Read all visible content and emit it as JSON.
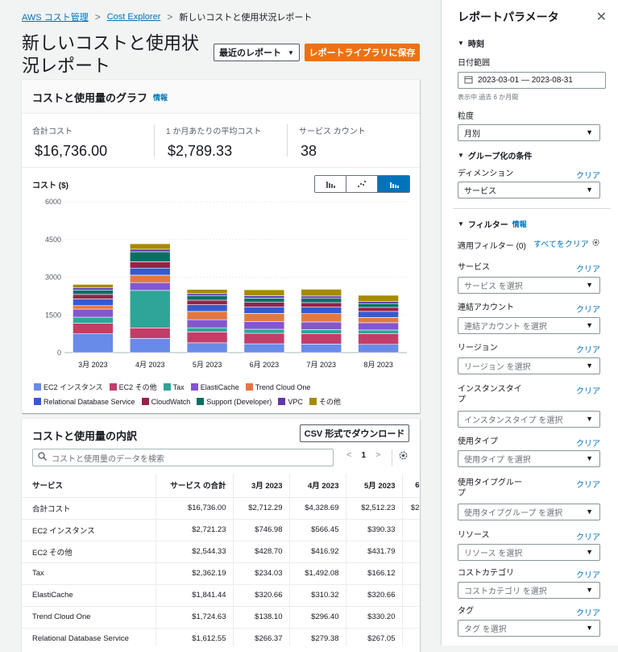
{
  "breadcrumb": {
    "item1": "AWS コスト管理",
    "item2": "Cost Explorer",
    "current": "新しいコストと使用状況レポート"
  },
  "page_title": "新しいコストと使用状況レポート",
  "buttons": {
    "recent_reports": "最近のレポート",
    "save_to_library": "レポートライブラリに保存",
    "csv_download": "CSV 形式でダウンロード"
  },
  "graph_card": {
    "title": "コストと使用量のグラフ",
    "info": "情報",
    "total_cost_label": "合計コスト",
    "total_cost": "$16,736.00",
    "avg_cost_label": "1 か月あたりの平均コスト",
    "avg_cost": "$2,789.33",
    "service_count_label": "サービス カウント",
    "service_count": "38",
    "chart_label": "コスト ($)"
  },
  "chart_data": {
    "type": "bar",
    "stacked": true,
    "ylabel": "コスト ($)",
    "ylim": [
      0,
      6000
    ],
    "yticks": [
      "0",
      "1500",
      "3000",
      "4500",
      "6000"
    ],
    "categories": [
      "3月 2023",
      "4月 2023",
      "5月 2023",
      "6月 2023",
      "7月 2023",
      "8月 2023"
    ],
    "series": [
      {
        "name": "EC2 インスタンス",
        "color": "#688ae8",
        "values": [
          746.98,
          566.45,
          390.33,
          350,
          340,
          330
        ]
      },
      {
        "name": "EC2 その他",
        "color": "#c33d69",
        "values": [
          428.7,
          416.92,
          431.79,
          420,
          420,
          420
        ]
      },
      {
        "name": "Tax",
        "color": "#2ea597",
        "values": [
          234.03,
          1492.08,
          166.12,
          160,
          160,
          150
        ]
      },
      {
        "name": "ElastiCache",
        "color": "#8456ce",
        "values": [
          320.66,
          310.32,
          320.66,
          300,
          300,
          290
        ]
      },
      {
        "name": "Trend Cloud One",
        "color": "#e07941",
        "values": [
          138.1,
          296.4,
          330.2,
          330,
          330,
          210
        ]
      },
      {
        "name": "Relational Database Service",
        "color": "#3759ce",
        "values": [
          266.37,
          279.38,
          267.05,
          260,
          260,
          240
        ]
      },
      {
        "name": "CloudWatch",
        "color": "#962249",
        "values": [
          180,
          250,
          180,
          180,
          180,
          160
        ]
      },
      {
        "name": "Support (Developer)",
        "color": "#096f64",
        "values": [
          170,
          400,
          170,
          170,
          170,
          150
        ]
      },
      {
        "name": "VPC",
        "color": "#6237a7",
        "values": [
          90,
          100,
          90,
          90,
          90,
          80
        ]
      },
      {
        "name": "その他",
        "color": "#a48b00",
        "values": [
          137.45,
          217.14,
          166.05,
          240,
          270,
          250
        ]
      }
    ]
  },
  "breakdown": {
    "title": "コストと使用量の内訳",
    "search_placeholder": "コストと使用量のデータを検索",
    "page": "1",
    "columns": [
      "サービス",
      "サービス の合計",
      "3月 2023",
      "4月 2023",
      "5月 2023",
      "6"
    ],
    "rows": [
      [
        "合計コスト",
        "$16,736.00",
        "$2,712.29",
        "$4,328.69",
        "$2,512.23",
        "$2"
      ],
      [
        "EC2 インスタンス",
        "$2,721.23",
        "$746.98",
        "$566.45",
        "$390.33",
        ""
      ],
      [
        "EC2 その他",
        "$2,544.33",
        "$428.70",
        "$416.92",
        "$431.79",
        ""
      ],
      [
        "Tax",
        "$2,362.19",
        "$234.03",
        "$1,492.08",
        "$166.12",
        ""
      ],
      [
        "ElastiCache",
        "$1,841.44",
        "$320.66",
        "$310.32",
        "$320.66",
        ""
      ],
      [
        "Trend Cloud One",
        "$1,724.63",
        "$138.10",
        "$296.40",
        "$330.20",
        ""
      ],
      [
        "Relational Database Service",
        "$1,612.55",
        "$266.37",
        "$279.38",
        "$267.05",
        ""
      ]
    ]
  },
  "panel": {
    "title": "レポートパラメータ",
    "time_section": "時刻",
    "date_range_label": "日付範囲",
    "date_range_value": "2023-03-01 — 2023-08-31",
    "date_hint": "表示中 過去 6 か月間",
    "granularity_label": "粒度",
    "granularity_value": "月別",
    "group_section": "グループ化の条件",
    "dimension_label": "ディメンション",
    "clear": "クリア",
    "dimension_value": "サービス",
    "filter_section": "フィルター",
    "filter_info": "情報",
    "applied_filters": "適用フィルター (0)",
    "clear_all": "すべてをクリア",
    "filters": [
      {
        "label": "サービス",
        "placeholder": "サービス を選択"
      },
      {
        "label": "連結アカウント",
        "placeholder": "連結アカウント を選択"
      },
      {
        "label": "リージョン",
        "placeholder": "リージョン を選択"
      },
      {
        "label": "インスタンスタイプ",
        "placeholder": "インスタンスタイプ を選択"
      },
      {
        "label": "使用タイプ",
        "placeholder": "使用タイプ を選択"
      },
      {
        "label": "使用タイプグループ",
        "placeholder": "使用タイプグループ を選択"
      },
      {
        "label": "リソース",
        "placeholder": "リソース を選択"
      },
      {
        "label": "コストカテゴリ",
        "placeholder": "コストカテゴリ を選択"
      },
      {
        "label": "タグ",
        "placeholder": "タグ を選択"
      }
    ]
  }
}
